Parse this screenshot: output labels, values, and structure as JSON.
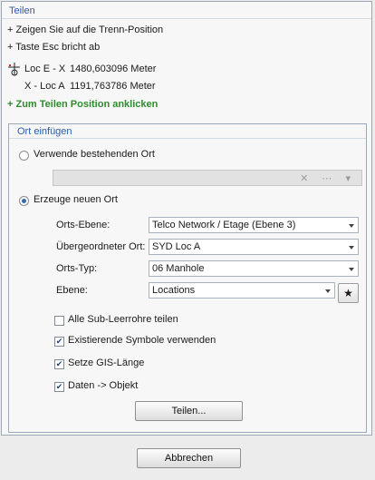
{
  "panel": {
    "title": "Teilen",
    "hints": [
      "+ Zeigen Sie auf die Trenn-Position",
      "+ Taste Esc bricht ab"
    ],
    "measure": {
      "row1_label": "Loc E - X",
      "row1_value": "1480,603096 Meter",
      "row2_label": "X - Loc A",
      "row2_value": "1191,763786 Meter"
    },
    "action_hint": "+ Zum Teilen Position anklicken"
  },
  "group": {
    "title": "Ort einfügen",
    "radio_existing": "Verwende bestehenden Ort",
    "existing_combo_buttons": "✕ ⋯ ▾",
    "radio_new": "Erzeuge neuen Ort",
    "fields": [
      {
        "label": "Orts-Ebene:",
        "value": "Telco Network / Etage (Ebene 3)"
      },
      {
        "label": "Übergeordneter Ort:",
        "value": "SYD Loc A"
      },
      {
        "label": "Orts-Typ:",
        "value": "06 Manhole"
      },
      {
        "label": "Ebene:",
        "value": "Locations"
      }
    ],
    "star_icon": "★",
    "checkboxes": [
      {
        "label": "Alle Sub-Leerrohre teilen",
        "checked": false
      },
      {
        "label": "Existierende Symbole verwenden",
        "checked": true
      },
      {
        "label": "Setze GIS-Länge",
        "checked": true
      },
      {
        "label": "Daten -> Objekt",
        "checked": true
      }
    ],
    "split_button": "Teilen..."
  },
  "cancel_button": "Abbrechen",
  "check_mark": "✔"
}
